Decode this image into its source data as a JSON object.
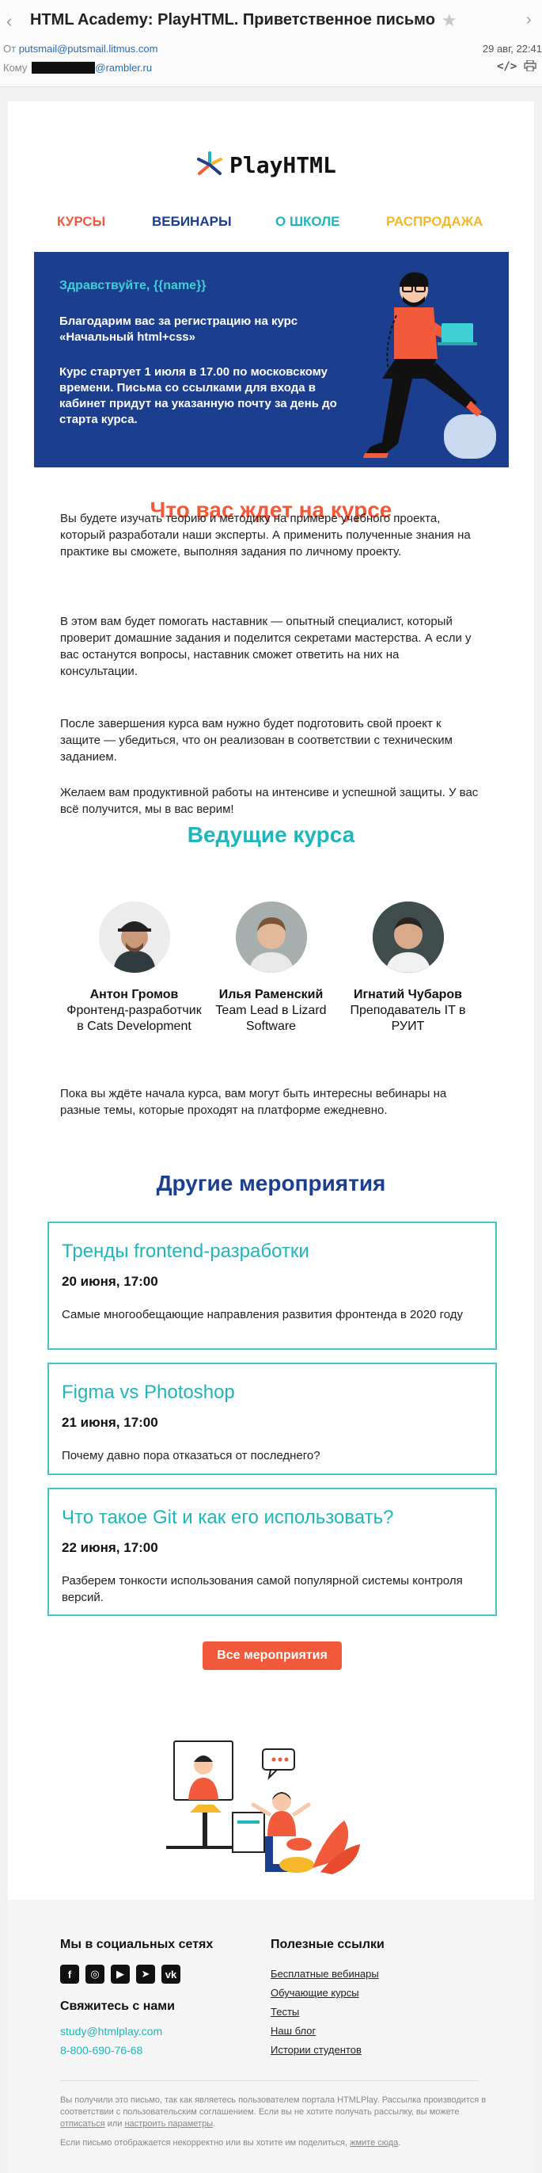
{
  "mail": {
    "subject": "HTML Academy: PlayHTML. Приветственное письмо",
    "from_label": "От",
    "from_addr": "putsmail@putsmail.litmus.com",
    "date": "29 авг, 22:41",
    "to_label": "Кому",
    "to_domain": "@rambler.ru",
    "code_glyph": "</>"
  },
  "logo": {
    "text": "PlayHTML"
  },
  "nav": [
    {
      "label": "КУРСЫ",
      "color": "#f15a3a"
    },
    {
      "label": "ВЕБИНАРЫ",
      "color": "#1b3e8f"
    },
    {
      "label": "О ШКОЛЕ",
      "color": "#1fb6bb"
    },
    {
      "label": "РАСПРОДАЖА",
      "color": "#f5b72a"
    }
  ],
  "hero": {
    "greeting": "Здравствуйте, {{name}}",
    "p1": "Благодарим вас за регистрацию на курс «Начальный html+css»",
    "p2": "Курс стартует 1 июля в 17.00 по московскому времени. Письма со ссылками для входа в кабинет придут на указанную почту за день до старта курса."
  },
  "about": {
    "title": "Что вас ждет на курсе",
    "paragraphs": [
      "Вы будете изучать теорию и методику на примере учебного проекта, который разработали наши эксперты. А применить полученные знания на практике вы сможете, выполняя задания по личному проекту.",
      "В этом вам будет помогать наставник — опытный специалист, который проверит домашние задания и поделится секретами мастерства. А если у вас останутся вопросы, наставник сможет ответить на них на консультации.",
      "После завершения курса вам нужно будет подготовить свой проект к защите — убедиться, что он реализован в соответствии с техническим заданием.",
      "Желаем вам продуктивной работы на интенсиве и успешной защиты. У вас всё получится, мы в вас верим!"
    ]
  },
  "teachers": {
    "title": "Ведущие курса",
    "items": [
      {
        "name": "Антон Громов",
        "role": "Фронтенд-разработчик в Cats Development"
      },
      {
        "name": "Илья Раменский",
        "role": "Team Lead в Lizard Software"
      },
      {
        "name": "Игнатий Чубаров",
        "role": "Преподаватель IT в РУИТ"
      }
    ],
    "note": "Пока вы ждёте начала курса, вам могут быть интересны вебинары на разные темы, которые проходят на платформе ежедневно."
  },
  "events": {
    "title": "Другие мероприятия",
    "items": [
      {
        "title": "Тренды frontend-разработки",
        "date": "20 июня, 17:00",
        "text": "Самые многообещающие направления развития фронтенда в 2020 году"
      },
      {
        "title": "Figma vs Photoshop",
        "date": "21 июня, 17:00",
        "text": "Почему давно пора отказаться от последнего?"
      },
      {
        "title": "Что такое Git и как его использовать?",
        "date": "22 июня, 17:00",
        "text": "Разберем тонкости использования самой популярной системы контроля версий."
      }
    ],
    "button": "Все мероприятия"
  },
  "footer": {
    "social_title": "Мы в социальных сетях",
    "social": [
      {
        "icon": "facebook-icon",
        "glyph": "f"
      },
      {
        "icon": "instagram-icon",
        "glyph": "◎"
      },
      {
        "icon": "youtube-icon",
        "glyph": "▶"
      },
      {
        "icon": "telegram-icon",
        "glyph": "➤"
      },
      {
        "icon": "vk-icon",
        "glyph": "vk"
      }
    ],
    "contact_title": "Свяжитесь с нами",
    "email": "study@htmlplay.com",
    "phone": "8-800-690-76-68",
    "links_title": "Полезные ссылки",
    "links": [
      "Бесплатные вебинары",
      "Обучающие курсы",
      "Тесты",
      "Наш блог",
      "Истории студентов"
    ],
    "legal_1": "Вы получили это письмо, так как являетесь пользователем портала HTMLPlay. Рассылка производится в соответствии с пользовательским соглашением. Если вы не хотите получать рассылку, вы можете",
    "legal_unsub": "отписаться",
    "legal_or": "или",
    "legal_settings": "настроить параметры",
    "legal_2": "Если письмо отображается некорректно или вы хотите им поделиться,",
    "legal_link": "жмите сюда"
  }
}
